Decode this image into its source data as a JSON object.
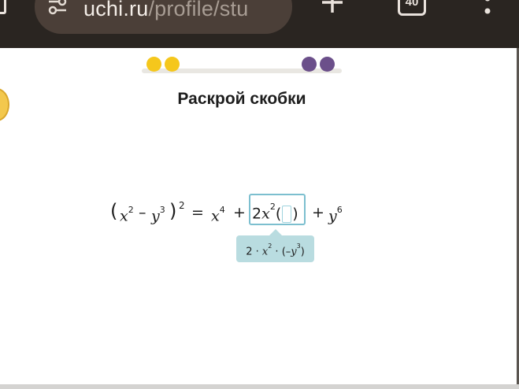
{
  "browser": {
    "url_host": "uchi.ru",
    "url_path": "/profile/stu",
    "tab_count": "40",
    "icons": [
      "tab-switcher-icon",
      "site-info-icon",
      "new-tab-icon",
      "tab-count-icon",
      "menu-icon"
    ]
  },
  "progress": {
    "dots": [
      {
        "color": "#f5c71c"
      },
      {
        "color": "#f5c71c"
      },
      {
        "color": "#6b4f8a"
      },
      {
        "color": "#6b4f8a"
      }
    ]
  },
  "task": {
    "title": "Раскрой скобки"
  },
  "equation": {
    "lhs_open_paren": "(",
    "lhs_x": "x",
    "lhs_x_exp": "2",
    "lhs_minus": "–",
    "lhs_y": "y",
    "lhs_y_exp": "3",
    "lhs_close_paren": ")",
    "lhs_outer_exp": "2",
    "equals": "=",
    "rhs_x": "x",
    "rhs_x_exp": "4",
    "plus1": "+",
    "answer_coef": "2",
    "answer_x": "x",
    "answer_x_exp": "2",
    "answer_open_paren": "(",
    "answer_close_paren": ")",
    "plus2": "+",
    "rhs_y": "y",
    "rhs_y_exp": "6"
  },
  "hint": {
    "text_2": "2 · ",
    "x": "x",
    "x_exp": "2",
    "dot2": " · (–",
    "y": "y",
    "y_exp": "3",
    "close": ")"
  },
  "colors": {
    "chrome_bg": "#2a2521",
    "omnibox_bg": "#4b3f38",
    "answer_border": "#7cbfcf",
    "hint_bg": "#b9dce0"
  }
}
